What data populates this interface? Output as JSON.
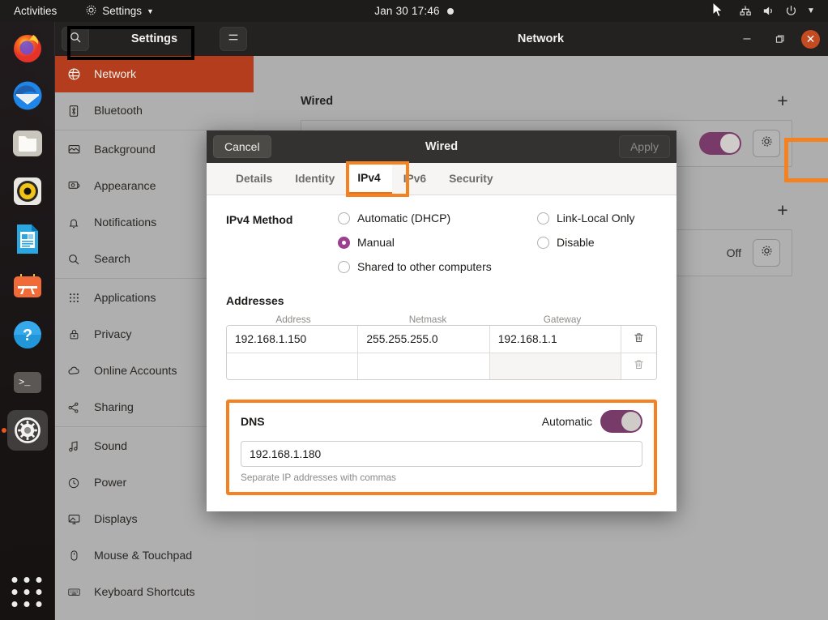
{
  "topbar": {
    "activities": "Activities",
    "app_menu": "Settings",
    "app_menu_icon": "gear-icon",
    "clock": "Jan 30  17:46",
    "notification_dot": "●",
    "tray_icons": [
      "network-wired-icon",
      "volume-icon",
      "power-icon",
      "chevron-down-icon"
    ]
  },
  "dock": {
    "items": [
      {
        "name": "firefox",
        "label": "Firefox"
      },
      {
        "name": "thunderbird",
        "label": "Thunderbird Mail"
      },
      {
        "name": "files",
        "label": "Files"
      },
      {
        "name": "rhythmbox",
        "label": "Rhythmbox"
      },
      {
        "name": "libreoffice-writer",
        "label": "LibreOffice Writer"
      },
      {
        "name": "ubuntu-software",
        "label": "Ubuntu Software"
      },
      {
        "name": "help",
        "label": "Help"
      },
      {
        "name": "terminal",
        "label": "Terminal"
      },
      {
        "name": "settings",
        "label": "Settings"
      }
    ],
    "show_apps_label": "Show Applications"
  },
  "settings_window": {
    "sidebar": {
      "title": "Settings",
      "search_icon": "search-icon",
      "menu_icon": "hamburger-menu-icon",
      "selected": "Network",
      "items": [
        {
          "label": "Network",
          "icon": "globe-icon"
        },
        {
          "label": "Bluetooth",
          "icon": "bluetooth-icon"
        },
        {
          "label": "Background",
          "icon": "background-icon"
        },
        {
          "label": "Appearance",
          "icon": "appearance-icon"
        },
        {
          "label": "Notifications",
          "icon": "bell-icon"
        },
        {
          "label": "Search",
          "icon": "search-icon"
        },
        {
          "label": "Applications",
          "icon": "apps-grid-icon"
        },
        {
          "label": "Privacy",
          "icon": "lock-icon"
        },
        {
          "label": "Online Accounts",
          "icon": "cloud-icon"
        },
        {
          "label": "Sharing",
          "icon": "share-icon"
        },
        {
          "label": "Sound",
          "icon": "music-note-icon"
        },
        {
          "label": "Power",
          "icon": "power-icon"
        },
        {
          "label": "Displays",
          "icon": "display-icon"
        },
        {
          "label": "Mouse & Touchpad",
          "icon": "mouse-icon"
        },
        {
          "label": "Keyboard Shortcuts",
          "icon": "keyboard-icon"
        }
      ]
    },
    "main": {
      "title": "Network",
      "window_controls": {
        "minimize": "–",
        "maximize": "❐",
        "close": "✕"
      },
      "sections": [
        {
          "title": "Wired",
          "add_label": "+",
          "toggle_state": "on",
          "settings_icon": "gear-icon"
        },
        {
          "title": "",
          "add_label": "+",
          "status": "Off",
          "settings_icon": "gear-icon"
        }
      ]
    }
  },
  "dialog": {
    "title": "Wired",
    "cancel_label": "Cancel",
    "apply_label": "Apply",
    "tabs": [
      {
        "label": "Details",
        "active": false
      },
      {
        "label": "Identity",
        "active": false
      },
      {
        "label": "IPv4",
        "active": true
      },
      {
        "label": "IPv6",
        "active": false
      },
      {
        "label": "Security",
        "active": false
      }
    ],
    "ipv4_method": {
      "label": "IPv4 Method",
      "options": [
        {
          "label": "Automatic (DHCP)",
          "selected": false
        },
        {
          "label": "Manual",
          "selected": true
        },
        {
          "label": "Shared to other computers",
          "selected": false
        },
        {
          "label": "Link-Local Only",
          "selected": false
        },
        {
          "label": "Disable",
          "selected": false
        }
      ]
    },
    "addresses": {
      "title": "Addresses",
      "columns": [
        "Address",
        "Netmask",
        "Gateway"
      ],
      "rows": [
        {
          "address": "192.168.1.150",
          "netmask": "255.255.255.0",
          "gateway": "192.168.1.1",
          "delete_icon": "trash-icon"
        },
        {
          "address": "",
          "netmask": "",
          "gateway": "",
          "delete_icon": "trash-icon"
        }
      ]
    },
    "dns": {
      "title": "DNS",
      "automatic_label": "Automatic",
      "automatic_state": "on",
      "value": "192.168.1.180",
      "placeholder": "",
      "hint": "Separate IP addresses with commas"
    }
  },
  "annotations": {
    "color_orange": "#f58220",
    "color_black": "#000000",
    "boxes": [
      "network-sidebar-item",
      "wired-gear-button",
      "ipv4-tab",
      "dns-section"
    ]
  }
}
